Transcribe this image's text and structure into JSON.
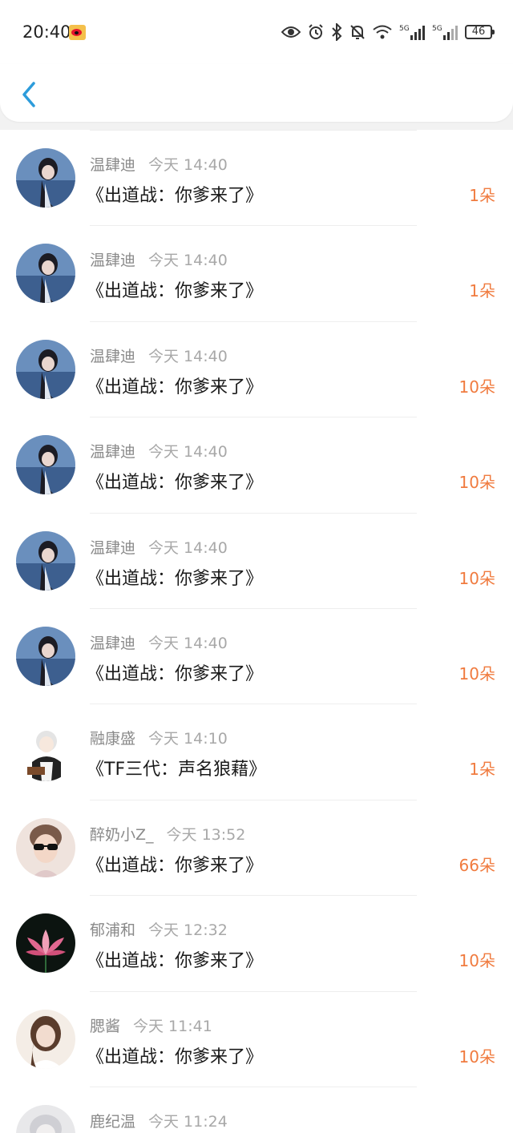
{
  "status_bar": {
    "time": "20:40",
    "battery": "46",
    "signal_labels": [
      "5G",
      "5G"
    ]
  },
  "header": {
    "back_icon": "chevron-left-icon",
    "accent_color": "#2d9cdb"
  },
  "colors": {
    "count": "#f07b3f",
    "name": "#8a8a8a",
    "title": "#1a1a1a"
  },
  "list": {
    "items": [
      {
        "name": "温肆迪",
        "time": "今天 14:40",
        "title": "《出道战：你爹来了》",
        "count": "1朵",
        "avatar": "girl-blue"
      },
      {
        "name": "温肆迪",
        "time": "今天 14:40",
        "title": "《出道战：你爹来了》",
        "count": "1朵",
        "avatar": "girl-blue"
      },
      {
        "name": "温肆迪",
        "time": "今天 14:40",
        "title": "《出道战：你爹来了》",
        "count": "10朵",
        "avatar": "girl-blue"
      },
      {
        "name": "温肆迪",
        "time": "今天 14:40",
        "title": "《出道战：你爹来了》",
        "count": "10朵",
        "avatar": "girl-blue"
      },
      {
        "name": "温肆迪",
        "time": "今天 14:40",
        "title": "《出道战：你爹来了》",
        "count": "10朵",
        "avatar": "girl-blue"
      },
      {
        "name": "温肆迪",
        "time": "今天 14:40",
        "title": "《出道战：你爹来了》",
        "count": "10朵",
        "avatar": "girl-blue"
      },
      {
        "name": "融康盛",
        "time": "今天 14:10",
        "title": "《TF三代：声名狼藉》",
        "count": "1朵",
        "avatar": "anime-white"
      },
      {
        "name": "醉奶小Z_",
        "time": "今天 13:52",
        "title": "《出道战：你爹来了》",
        "count": "66朵",
        "avatar": "boy-sunglasses"
      },
      {
        "name": "郁浦和",
        "time": "今天 12:32",
        "title": "《出道战：你爹来了》",
        "count": "10朵",
        "avatar": "lotus"
      },
      {
        "name": "腮酱",
        "time": "今天 11:41",
        "title": "《出道战：你爹来了》",
        "count": "10朵",
        "avatar": "girl-white"
      },
      {
        "name": "鹿纪温",
        "time": "今天 11:24",
        "title": "",
        "count": "",
        "avatar": "grey-portrait"
      }
    ]
  }
}
